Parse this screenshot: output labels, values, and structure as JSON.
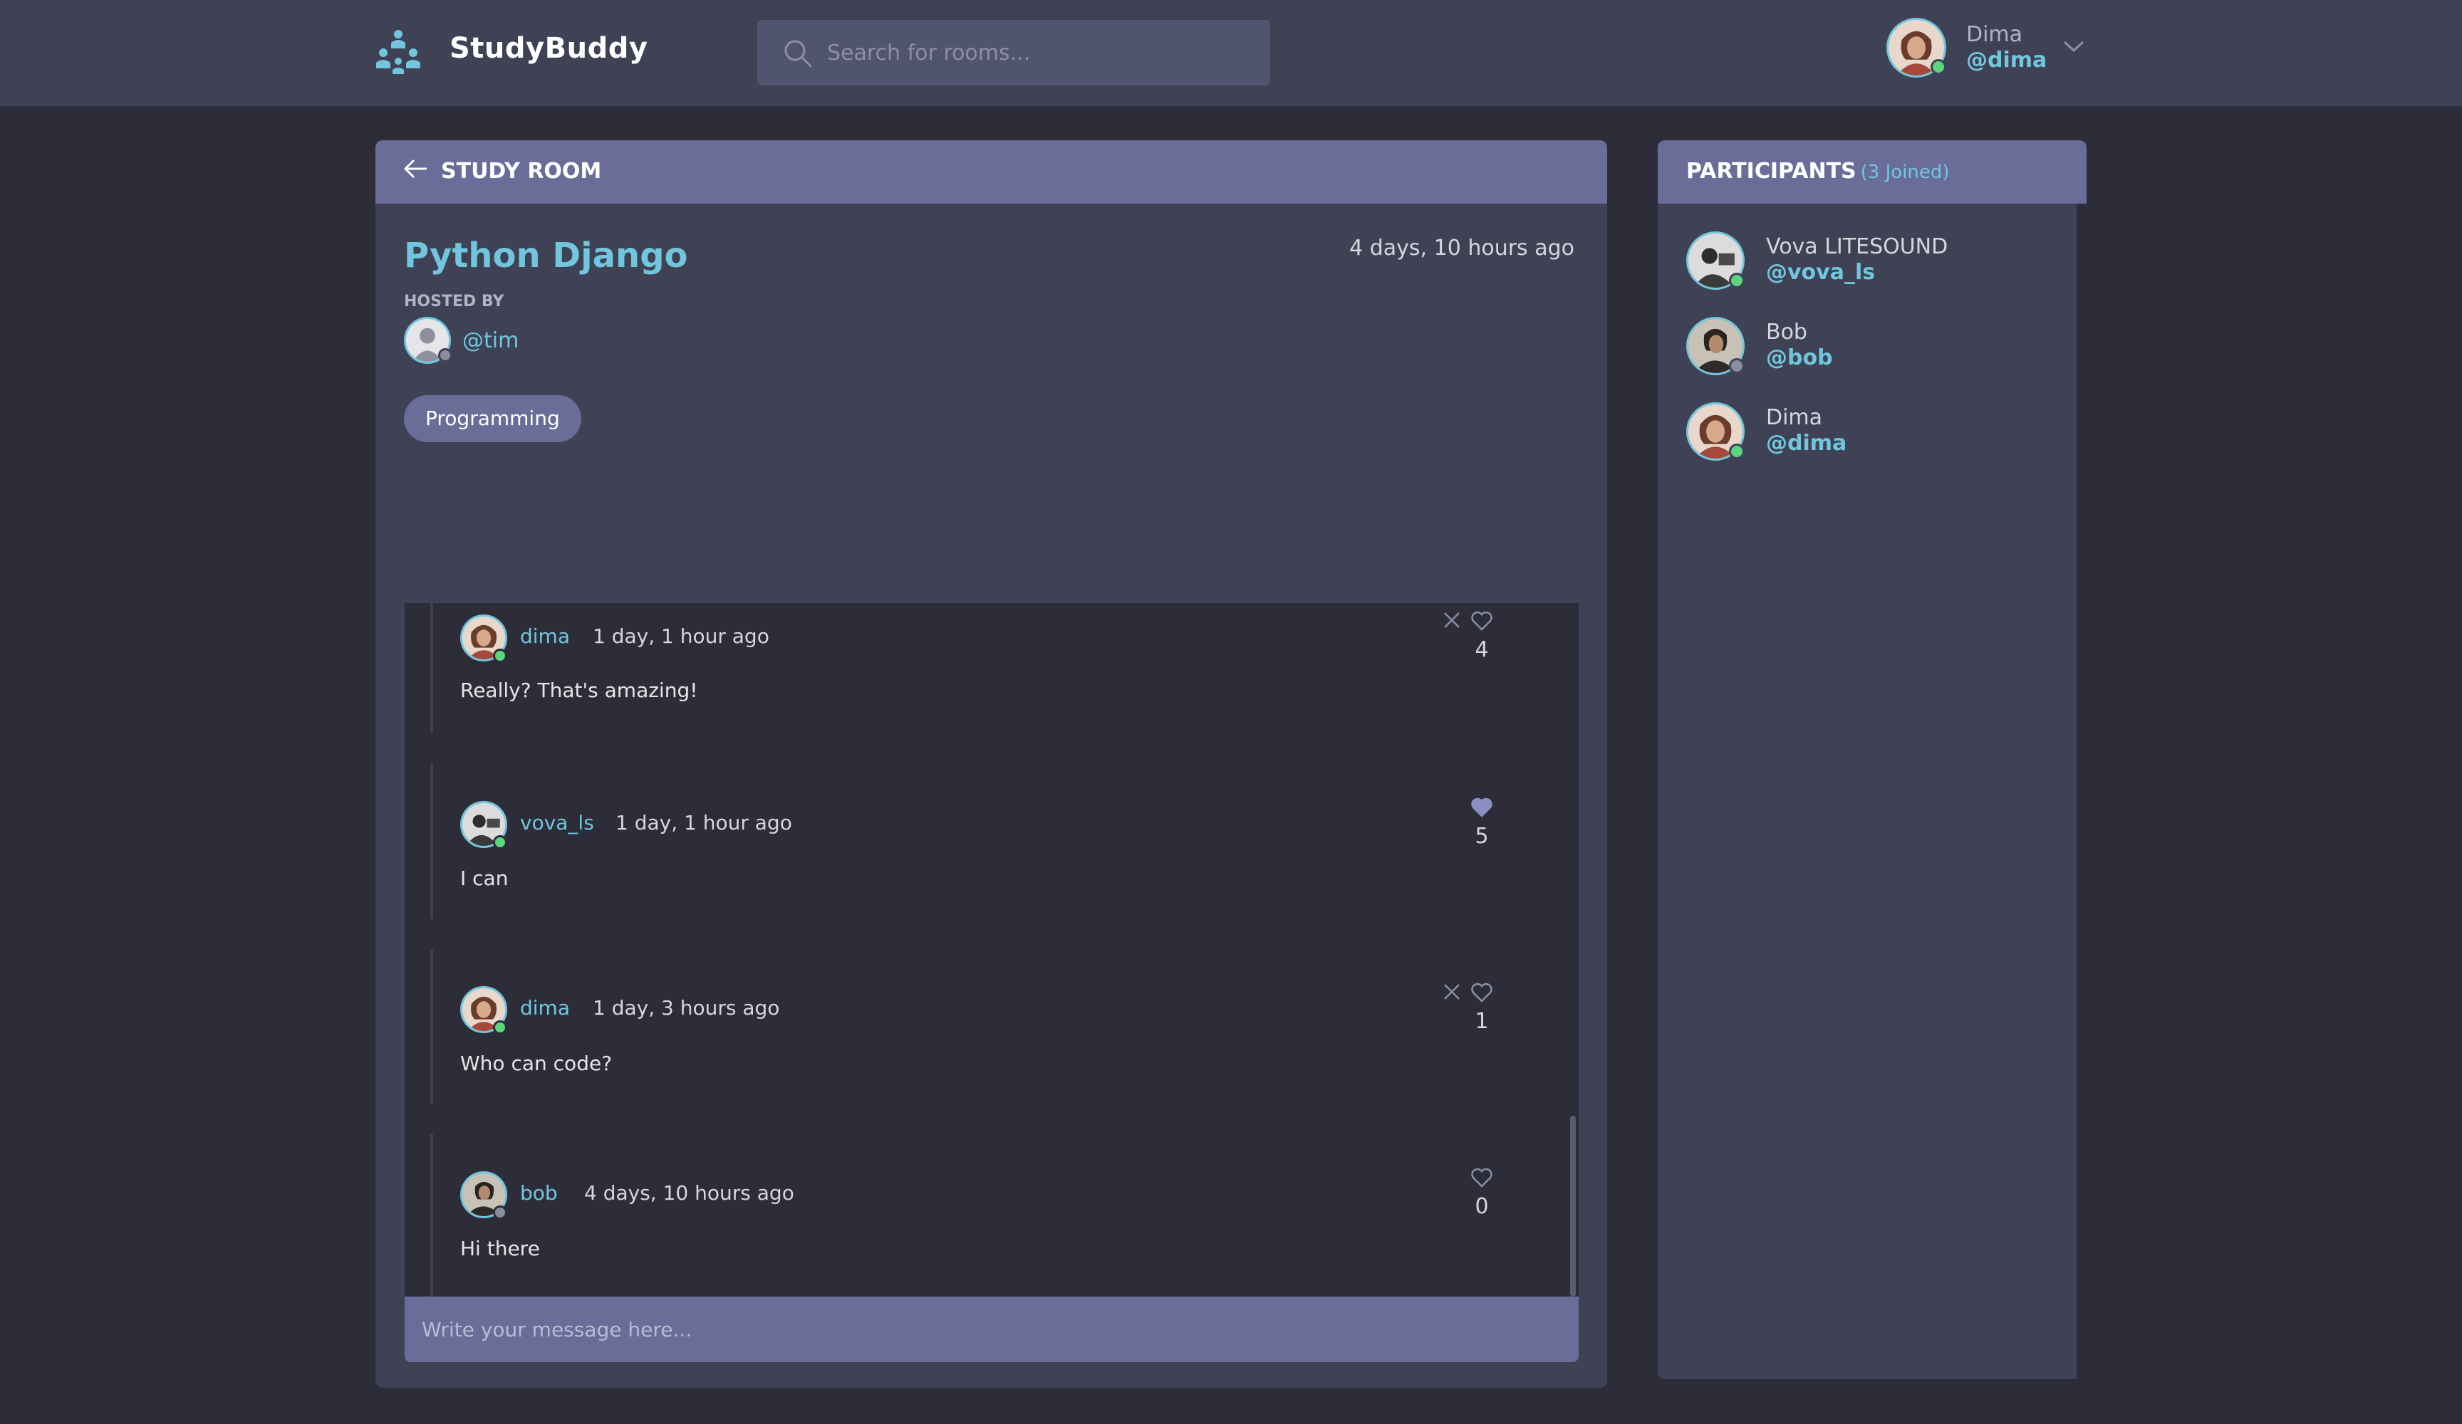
{
  "app": {
    "brand": "StudyBuddy",
    "logo_icon": "study-buddy-logo-icon"
  },
  "search": {
    "placeholder": "Search for rooms...",
    "value": ""
  },
  "user": {
    "name": "Dima",
    "handle": "@dima",
    "status": "online"
  },
  "room": {
    "header_label": "STUDY ROOM",
    "title": "Python Django",
    "created": "4 days, 10 hours ago",
    "hosted_by_label": "HOSTED BY",
    "host": "@tim",
    "topic": "Programming"
  },
  "messages": [
    {
      "author": "dima",
      "time": "1 day, 1 hour ago",
      "body": "Really? That's amazing!",
      "likes": "4",
      "liked": false,
      "deletable": true
    },
    {
      "author": "vova_ls",
      "time": "1 day, 1 hour ago",
      "body": "I can",
      "likes": "5",
      "liked": true,
      "deletable": false
    },
    {
      "author": "dima",
      "time": "1 day, 3 hours ago",
      "body": "Who can code?",
      "likes": "1",
      "liked": false,
      "deletable": true
    },
    {
      "author": "bob",
      "time": "4 days, 10 hours ago",
      "body": "Hi there",
      "likes": "0",
      "liked": false,
      "deletable": false
    }
  ],
  "composer": {
    "placeholder": "Write your message here...",
    "value": ""
  },
  "participants": {
    "title": "PARTICIPANTS",
    "count_label": "(3 Joined)",
    "list": [
      {
        "name": "Vova LITESOUND",
        "handle": "@vova_ls",
        "status": "online"
      },
      {
        "name": "Bob",
        "handle": "@bob",
        "status": "offline"
      },
      {
        "name": "Dima",
        "handle": "@dima",
        "status": "online"
      }
    ]
  },
  "colors": {
    "background": "#2d2d39",
    "panel": "#3f4155",
    "panel_header": "#696d97",
    "accent": "#71c6dd",
    "online": "#5ad67d",
    "offline": "#8b8e9e"
  }
}
